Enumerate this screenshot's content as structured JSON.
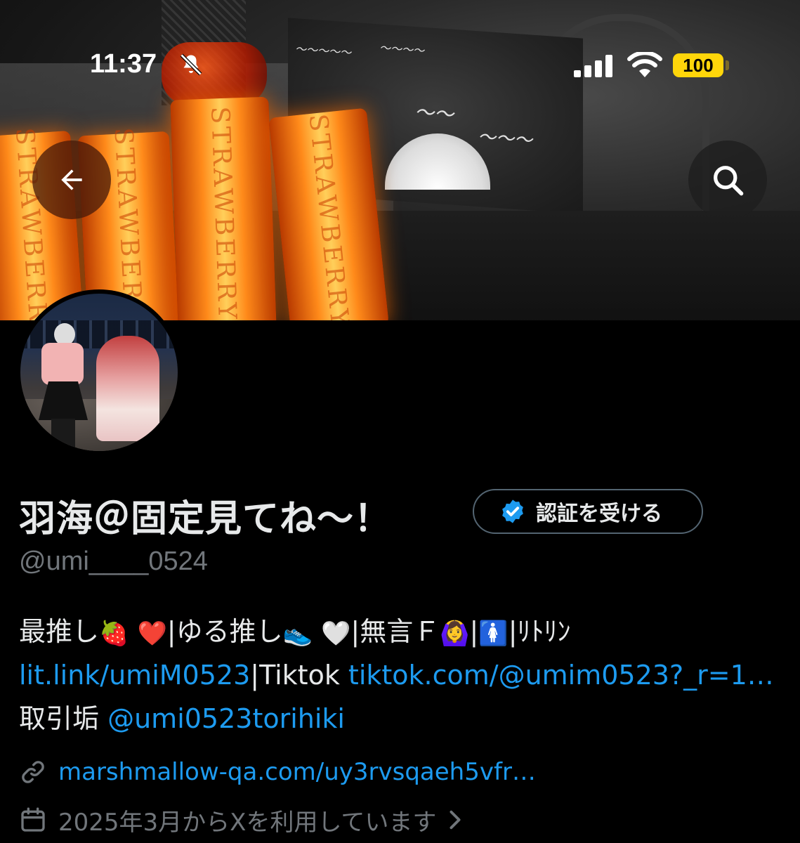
{
  "status_bar": {
    "time": "11:37",
    "battery": "100",
    "icons": [
      "bell-slash-icon",
      "signal-icon",
      "wifi-icon"
    ]
  },
  "banner": {
    "glowsticks": [
      "STRAWBERRY",
      "STRAWBERRY",
      "STRAWBERRY",
      "STRAWBERRY"
    ]
  },
  "nav": {
    "back_icon": "arrow-left-icon",
    "search_icon": "search-icon"
  },
  "profile": {
    "display_name": "羽海＠固定見てね〜！",
    "verify_button": "認証を受ける",
    "handle": "@umi____0524",
    "bio": {
      "t1": "最推し",
      "e1": "🍓",
      "e2": "❤️",
      "t2": "|ゆる推し",
      "e3": "👟",
      "e4": "🤍",
      "t3": "|無言Ｆ",
      "e5": "🙆‍♀️",
      "t4": "|",
      "e6": "🚺",
      "t5": "|ﾘﾄﾘﾝ",
      "link1": "lit.link/umiM0523",
      "t6": "|Tiktok ",
      "link2": "tiktok.com/@umim0523?_r=1…",
      "t7": "取引垢 ",
      "link3": "@umi0523torihiki"
    },
    "website": "marshmallow-qa.com/uy3rvsqaeh5vfr…",
    "joined": "2025年3月からXを利用しています"
  },
  "colors": {
    "background": "#000000",
    "link": "#1d9bf0",
    "muted": "#71767b",
    "verify_badge": "#1d9bf0",
    "battery": "#ffd60a"
  }
}
